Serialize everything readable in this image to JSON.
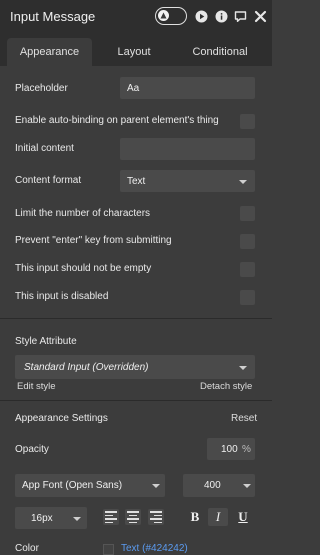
{
  "window": {
    "title": "Input Message"
  },
  "tabs": [
    {
      "label": "Appearance"
    },
    {
      "label": "Layout"
    },
    {
      "label": "Conditional"
    }
  ],
  "fields": {
    "placeholder_label": "Placeholder",
    "placeholder_value": "Aa",
    "autobinding_label": "Enable auto-binding on parent element's thing",
    "initial_content_label": "Initial content",
    "initial_content_value": "",
    "content_format_label": "Content format",
    "content_format_value": "Text",
    "limit_chars_label": "Limit the number of characters",
    "prevent_enter_label": "Prevent \"enter\" key from submitting",
    "not_empty_label": "This input should not be empty",
    "disabled_label": "This input is disabled"
  },
  "style": {
    "section_label": "Style Attribute",
    "selected_style": "Standard Input (Overridden)",
    "edit_style": "Edit style",
    "detach_style": "Detach style"
  },
  "appearance_settings": {
    "label": "Appearance Settings",
    "reset": "Reset",
    "opacity_label": "Opacity",
    "opacity_value": "100",
    "opacity_unit": "%",
    "font_family": "App Font (Open Sans)",
    "font_weight": "400",
    "font_size": "16px",
    "bold": "B",
    "italic": "I",
    "underline": "U",
    "color_label": "Color",
    "color_value": "Text (#424242)",
    "color_swatch": "#424242"
  },
  "colors": {
    "background": "#3c3c3c",
    "titlebar": "#2e2e2e",
    "field": "#4a4a4a",
    "link_blue": "#5b9bf0"
  }
}
